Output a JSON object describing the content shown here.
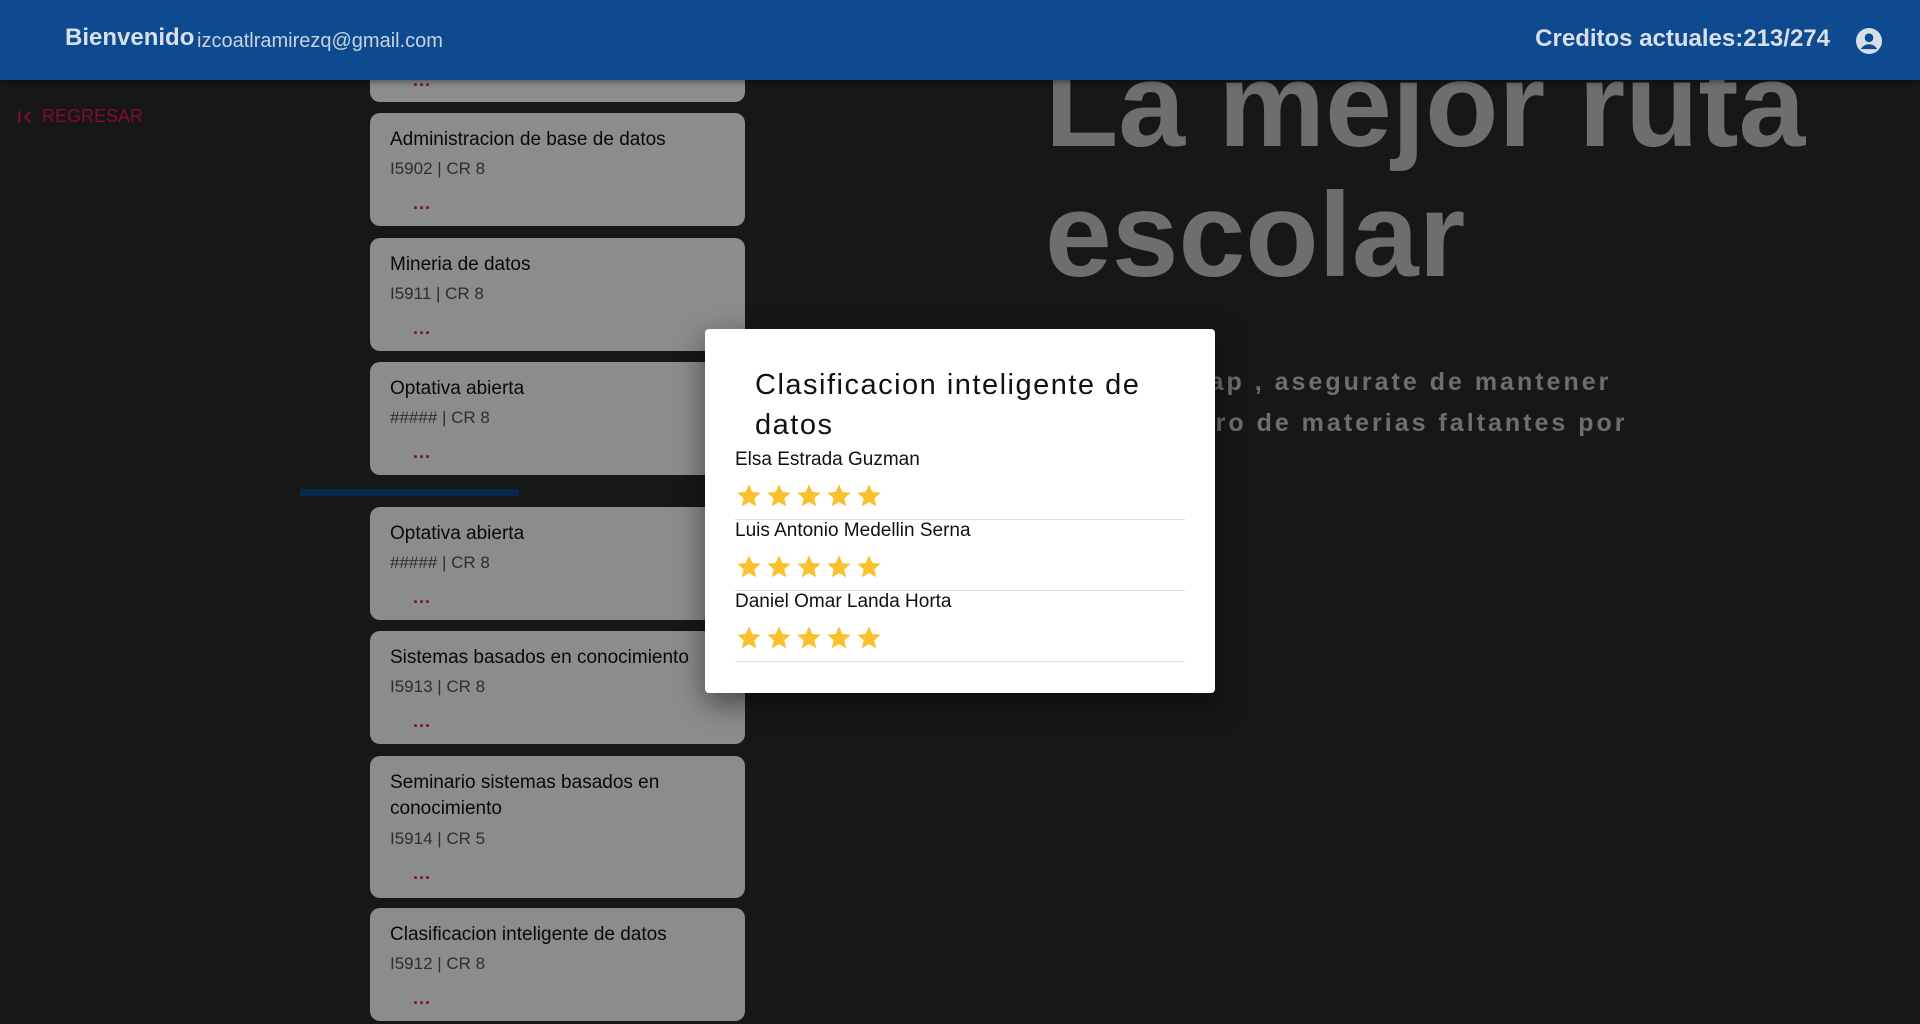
{
  "header": {
    "welcome": "Bienvenido",
    "email": "izcoatlramirezq@gmail.com",
    "credits": "Creditos actuales:213/274"
  },
  "back": {
    "label": "REGRESAR"
  },
  "subjects": [
    {
      "name": "",
      "code": "",
      "more": "..."
    },
    {
      "name": "Administracion de base de datos",
      "code": "I5902 | CR 8",
      "more": "..."
    },
    {
      "name": "Mineria de datos",
      "code": "I5911 | CR 8",
      "more": "..."
    },
    {
      "name": "Optativa abierta",
      "code": "##### | CR 8",
      "more": "..."
    },
    {
      "name": "Optativa abierta",
      "code": "##### | CR 8",
      "more": "..."
    },
    {
      "name": "Sistemas basados en conocimiento",
      "code": "I5913 | CR 8",
      "more": "..."
    },
    {
      "name": "Seminario sistemas basados en conocimiento",
      "code": "I5914 | CR 5",
      "more": "..."
    },
    {
      "name": "Clasificacion inteligente de datos",
      "code": "I5912 | CR 8",
      "more": "..."
    }
  ],
  "hero": {
    "title": "La mejor ruta escolar",
    "subtitle_line1": "u roadmap , asegurate de mantener",
    "subtitle_line2": "tu registro de materias faltantes por"
  },
  "modal": {
    "title": "Clasificacion inteligente de datos",
    "reviews": [
      {
        "teacher": "Elsa Estrada Guzman",
        "rating": 5
      },
      {
        "teacher": "Luis Antonio Medellin Serna",
        "rating": 5
      },
      {
        "teacher": "Daniel Omar Landa Horta",
        "rating": 5
      }
    ]
  },
  "colors": {
    "topbar": "#0d4a8f",
    "accent": "#e8175d",
    "star": "#fbc02d"
  }
}
